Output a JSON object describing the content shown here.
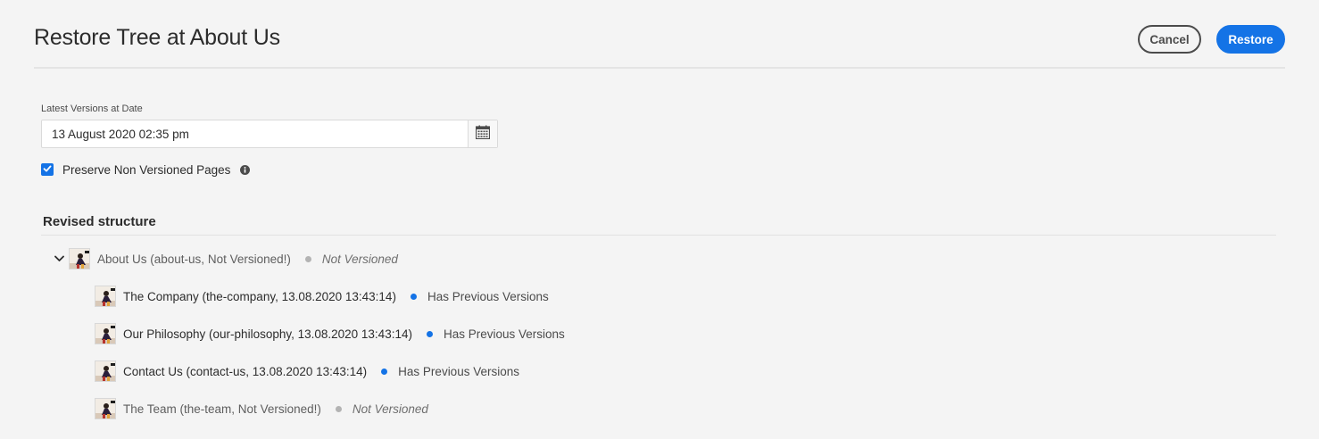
{
  "header": {
    "title": "Restore Tree at About Us",
    "cancel_label": "Cancel",
    "restore_label": "Restore"
  },
  "form": {
    "date_label": "Latest Versions at Date",
    "date_value": "13 August 2020 02:35 pm",
    "calendar_icon": "calendar-icon",
    "checkbox_label": "Preserve Non Versioned Pages",
    "checkbox_checked": true,
    "info_icon": "info-icon"
  },
  "structure": {
    "title": "Revised structure",
    "root": {
      "label": "About Us (about-us, Not Versioned!)",
      "status": "Not Versioned",
      "status_color": "#b3b3b3",
      "expanded": true
    },
    "children": [
      {
        "label": "The Company (the-company, 13.08.2020 13:43:14)",
        "status": "Has Previous Versions",
        "status_color": "#1473e6"
      },
      {
        "label": "Our Philosophy (our-philosophy, 13.08.2020 13:43:14)",
        "status": "Has Previous Versions",
        "status_color": "#1473e6"
      },
      {
        "label": "Contact Us (contact-us, 13.08.2020 13:43:14)",
        "status": "Has Previous Versions",
        "status_color": "#1473e6"
      },
      {
        "label": "The Team (the-team, Not Versioned!)",
        "status": "Not Versioned",
        "status_color": "#b3b3b3"
      }
    ]
  },
  "colors": {
    "accent": "#1473e6",
    "background": "#f4f4f4",
    "not_versioned": "#b3b3b3"
  }
}
